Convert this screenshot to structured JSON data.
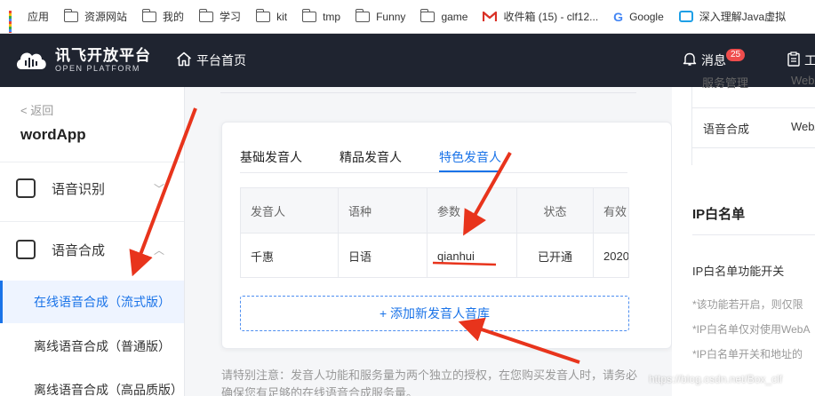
{
  "bookmarks": [
    {
      "label": "应用",
      "icon": "apps-grid-icon"
    },
    {
      "label": "资源网站",
      "icon": "folder-icon"
    },
    {
      "label": "我的",
      "icon": "folder-icon"
    },
    {
      "label": "学习",
      "icon": "folder-icon"
    },
    {
      "label": "kit",
      "icon": "folder-icon"
    },
    {
      "label": "tmp",
      "icon": "folder-icon"
    },
    {
      "label": "Funny",
      "icon": "folder-icon"
    },
    {
      "label": "game",
      "icon": "folder-icon"
    },
    {
      "label": "收件箱 (15) - clf12...",
      "icon": "gmail-icon"
    },
    {
      "label": "Google",
      "icon": "google-icon"
    },
    {
      "label": "深入理解Java虚拟",
      "icon": "bilibili-icon"
    }
  ],
  "nav": {
    "brand_cn": "讯飞开放平台",
    "brand_en": "OPEN PLATFORM",
    "home": "平台首页",
    "messages": "消息",
    "messages_badge": "25",
    "work": "工"
  },
  "sidebar": {
    "back": "< 返回",
    "app_name": "wordApp",
    "menu": [
      {
        "label": "语音识别",
        "chevron": "﹀"
      },
      {
        "label": "语音合成",
        "chevron": "︿"
      }
    ],
    "sub_items": [
      {
        "label": "在线语音合成（流式版）"
      },
      {
        "label": "离线语音合成（普通版）"
      },
      {
        "label": "离线语音合成（高品质版）"
      }
    ]
  },
  "tabs": [
    {
      "label": "基础发音人"
    },
    {
      "label": "精品发音人"
    },
    {
      "label": "特色发音人"
    }
  ],
  "table": {
    "headers": [
      "发音人",
      "语种",
      "参数",
      "状态",
      "有效"
    ],
    "rows": [
      [
        "千惠",
        "日语",
        "qianhui",
        "已开通",
        "2020"
      ]
    ]
  },
  "add_button": "+ 添加新发音人音库",
  "note": "请特别注意：发音人功能和服务量为两个独立的授权，在您购买发音人时，请务必确保您有足够的在线语音合成服务量。",
  "right_panel": {
    "cut_label": "服务管理",
    "cut_value": "WebAPI",
    "row_label": "语音合成",
    "row_value": "WebAPI",
    "ip_title": "IP白名单",
    "ip_switch": "IP白名单功能开关",
    "desc": [
      "*该功能若开启，则仅限",
      "*IP白名单仅对使用WebA",
      "*IP白名单开关和地址的"
    ]
  },
  "watermark": "https://blog.csdn.net/Box_clf",
  "colors": {
    "nav_bg": "#1f2430",
    "accent": "#1a73e8",
    "arrow": "#e8341c",
    "badge": "#ef4d4d"
  }
}
